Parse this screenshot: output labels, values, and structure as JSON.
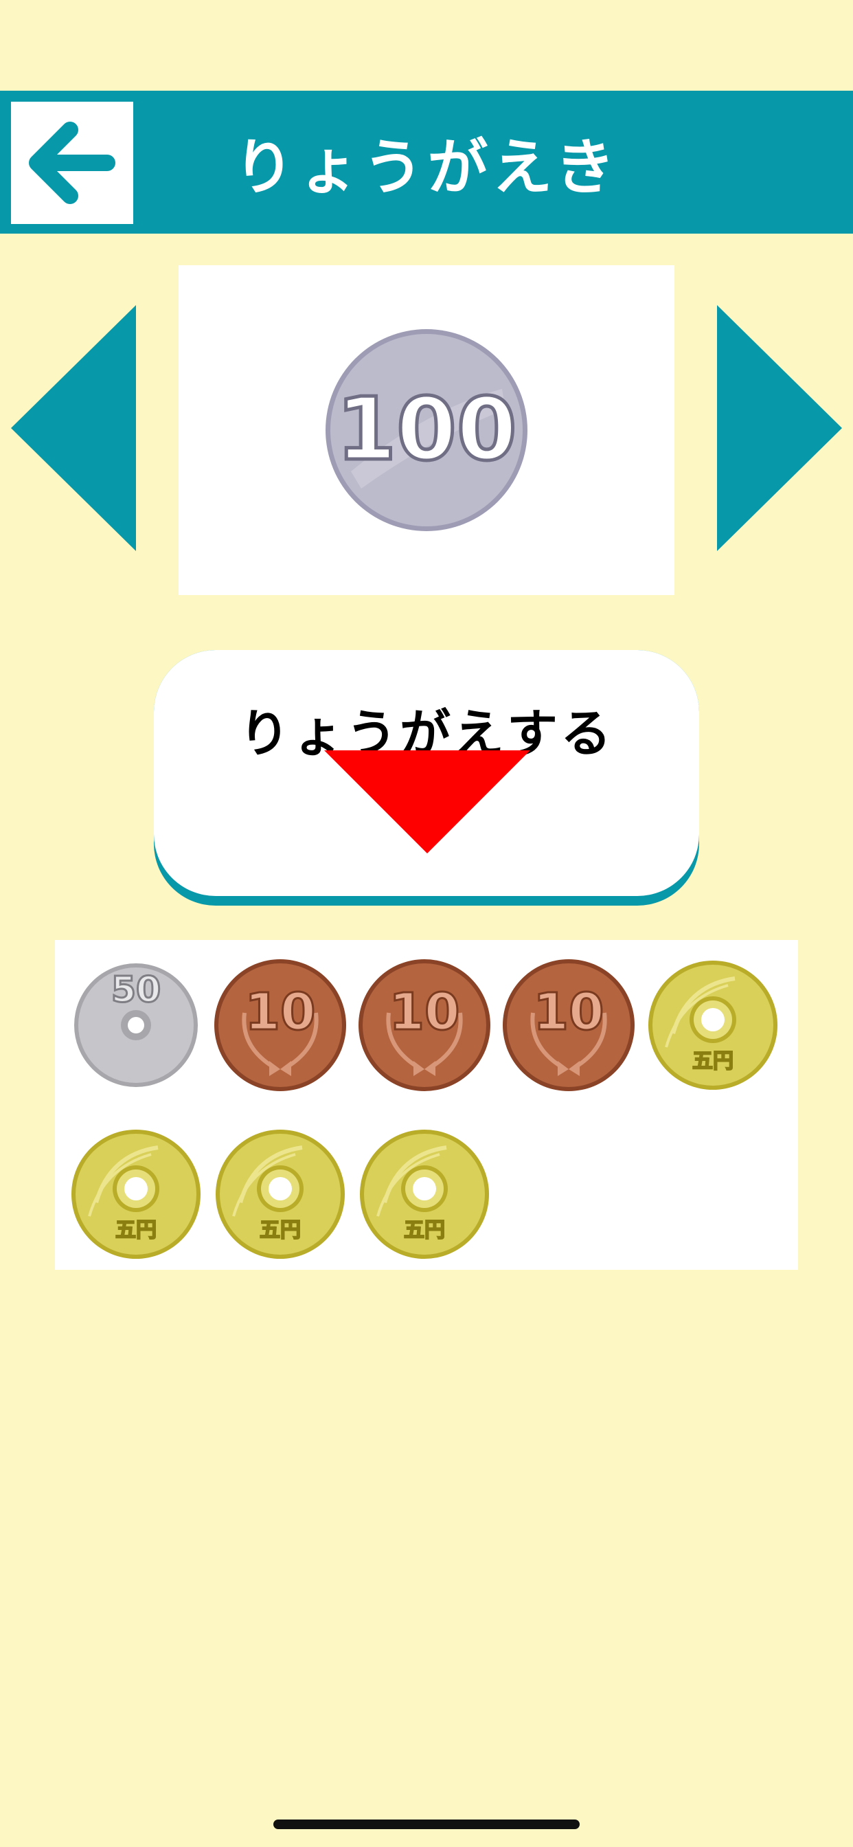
{
  "header": {
    "title": "りょうがえき",
    "back_icon": "arrow-left-icon"
  },
  "nav": {
    "prev_icon": "triangle-left-icon",
    "next_icon": "triangle-right-icon"
  },
  "current_coin": {
    "value_label": "100",
    "type": "silver"
  },
  "exchange_button": {
    "label": "りょうがえする",
    "icon": "triangle-down-icon"
  },
  "result_coins": [
    {
      "kind": "50",
      "label": "50"
    },
    {
      "kind": "10",
      "label": "10"
    },
    {
      "kind": "10",
      "label": "10"
    },
    {
      "kind": "10",
      "label": "10"
    },
    {
      "kind": "5",
      "label": "五円"
    },
    {
      "kind": "5",
      "label": "五円"
    },
    {
      "kind": "5",
      "label": "五円"
    },
    {
      "kind": "5",
      "label": "五円"
    }
  ],
  "colors": {
    "background": "#fdf7c3",
    "accent": "#0799a9",
    "arrow_red": "#ff0000",
    "silver": "#b9b8c8",
    "copper": "#b4643e",
    "gold": "#d9d05a"
  }
}
